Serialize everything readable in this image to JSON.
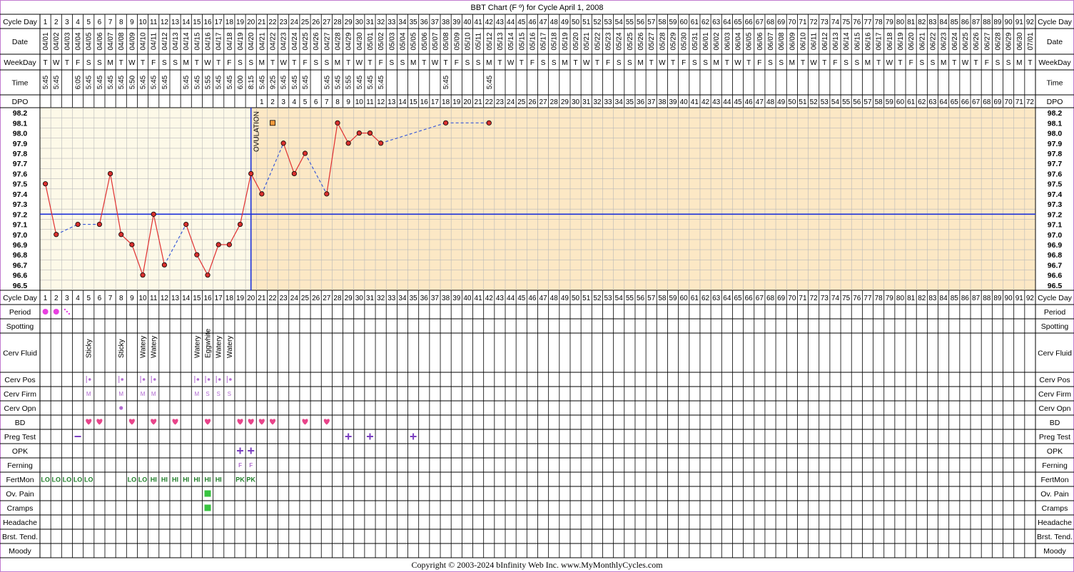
{
  "title": "BBT Chart (F º) for Cycle April 1, 2008",
  "footer": "Copyright © 2003-2024 bInfinity Web Inc.     www.MyMonthlyCycles.com",
  "ovulation_label": "OVULATION",
  "row_labels": {
    "cycle_day": "Cycle Day",
    "date": "Date",
    "weekday": "WeekDay",
    "time": "Time",
    "dpo": "DPO",
    "period": "Period",
    "spotting": "Spotting",
    "cerv_fluid": "Cerv Fluid",
    "cerv_pos": "Cerv Pos",
    "cerv_firm": "Cerv Firm",
    "cerv_opn": "Cerv Opn",
    "bd": "BD",
    "preg_test": "Preg Test",
    "opk": "OPK",
    "ferning": "Ferning",
    "fertmon": "FertMon",
    "ov_pain": "Ov. Pain",
    "cramps": "Cramps",
    "headache": "Headache",
    "brst_tend": "Brst. Tend.",
    "moody": "Moody"
  },
  "colors": {
    "frame": "#c27bcf",
    "pre_ovulation_bg": "#fdf9e8",
    "post_ovulation_bg": "#fce8c5",
    "temp_line": "#e03030",
    "temp_point": "#d8302e",
    "coverline": "#1a2fd8",
    "ovulation_line": "#1a2fd8",
    "period": "#e83fe0",
    "bd_heart": "#e8448a",
    "cervix_marker": "#b06ad0",
    "fertmon": "#1e7d28",
    "symptom": "#38c440",
    "plus_sign": "#7a3fc0"
  },
  "chart_data": {
    "type": "line",
    "title": "BBT Chart (F º) for Cycle April 1, 2008",
    "x_label": "Cycle Day",
    "y_label": "",
    "ylim": [
      96.5,
      98.2
    ],
    "y_ticks": [
      "98.2",
      "98.1",
      "98.0",
      "97.9",
      "97.8",
      "97.7",
      "97.6",
      "97.5",
      "97.4",
      "97.3",
      "97.2",
      "97.1",
      "97.0",
      "96.9",
      "96.8",
      "96.7",
      "96.6",
      "96.5"
    ],
    "coverline": 97.2,
    "ovulation_day": 20,
    "cycle_days": [
      1,
      2,
      3,
      4,
      5,
      6,
      7,
      8,
      9,
      10,
      11,
      12,
      13,
      14,
      15,
      16,
      17,
      18,
      19,
      20,
      21,
      22,
      23,
      24,
      25,
      26,
      27,
      28,
      29,
      30,
      31,
      32,
      33,
      34,
      35,
      36,
      37,
      38,
      39,
      40,
      41,
      42,
      43,
      44,
      45,
      46,
      47,
      48,
      49,
      50,
      51,
      52,
      53,
      54,
      55,
      56,
      57,
      58,
      59,
      60,
      61,
      62,
      63,
      64,
      65,
      66,
      67,
      68,
      69,
      70,
      71,
      72,
      73,
      74,
      75,
      76,
      77,
      78,
      79,
      80,
      81,
      82,
      83,
      84,
      85,
      86,
      87,
      88,
      89,
      90,
      91,
      92
    ],
    "dates": [
      "04/01",
      "04/02",
      "04/03",
      "04/04",
      "04/05",
      "04/06",
      "04/07",
      "04/08",
      "04/09",
      "04/10",
      "04/11",
      "04/12",
      "04/13",
      "04/14",
      "04/15",
      "04/16",
      "04/17",
      "04/18",
      "04/19",
      "04/20",
      "04/21",
      "04/22",
      "04/23",
      "04/24",
      "04/25",
      "04/26",
      "04/27",
      "04/28",
      "04/29",
      "04/30",
      "05/01",
      "05/02",
      "05/03",
      "05/04",
      "05/05",
      "05/06",
      "05/07",
      "05/08",
      "05/09",
      "05/10",
      "05/11",
      "05/12",
      "05/13",
      "05/14",
      "05/15",
      "05/16",
      "05/17",
      "05/18",
      "05/19",
      "05/20",
      "05/21",
      "05/22",
      "05/23",
      "05/24",
      "05/25",
      "05/26",
      "05/27",
      "05/28",
      "05/29",
      "05/30",
      "05/31",
      "06/01",
      "06/02",
      "06/03",
      "06/04",
      "06/05",
      "06/06",
      "06/07",
      "06/08",
      "06/09",
      "06/10",
      "06/11",
      "06/12",
      "06/13",
      "06/14",
      "06/15",
      "06/16",
      "06/17",
      "06/18",
      "06/19",
      "06/20",
      "06/21",
      "06/22",
      "06/23",
      "06/24",
      "06/25",
      "06/26",
      "06/27",
      "06/28",
      "06/29",
      "06/30",
      "07/01"
    ],
    "weekdays": [
      "T",
      "W",
      "T",
      "F",
      "S",
      "S",
      "M",
      "T",
      "W",
      "T",
      "F",
      "S",
      "S",
      "M",
      "T",
      "W",
      "T",
      "F",
      "S",
      "S",
      "M",
      "T",
      "W",
      "T",
      "F",
      "S",
      "S",
      "M",
      "T",
      "W",
      "T",
      "F",
      "S",
      "S",
      "M",
      "T",
      "W",
      "T",
      "F",
      "S",
      "S",
      "M",
      "T",
      "W",
      "T",
      "F",
      "S",
      "S",
      "M",
      "T",
      "W",
      "T",
      "F",
      "S",
      "S",
      "M",
      "T",
      "W",
      "T",
      "F",
      "S",
      "S",
      "M",
      "T",
      "W",
      "T",
      "F",
      "S",
      "S",
      "M",
      "T",
      "W",
      "T",
      "F",
      "S",
      "S",
      "M",
      "T",
      "W",
      "T",
      "F",
      "S",
      "S",
      "M",
      "T",
      "W",
      "T",
      "F",
      "S",
      "S",
      "M",
      "T"
    ],
    "times": [
      "5:45",
      "5:45",
      "",
      "6:05",
      "5:45",
      "5:45",
      "5:45",
      "5:45",
      "5:50",
      "5:45",
      "5:45",
      "5:45",
      "",
      "5:45",
      "5:45",
      "5:55",
      "5:45",
      "5:45",
      "6:00",
      "8:15",
      "5:45",
      "9:25",
      "5:45",
      "5:45",
      "5:45",
      "",
      "5:45",
      "5:45",
      "5:55",
      "5:45",
      "5:45",
      "5:45",
      "",
      "",
      "",
      "",
      "",
      "5:45",
      "",
      "",
      "",
      "5:45",
      "",
      "",
      "",
      "",
      "",
      "",
      "",
      "",
      "",
      "",
      "",
      "",
      "",
      "",
      "",
      "",
      "",
      "",
      "",
      "",
      "",
      "",
      "",
      "",
      "",
      "",
      "",
      "",
      "",
      "",
      "",
      "",
      "",
      "",
      "",
      "",
      "",
      "",
      "",
      "",
      "",
      "",
      "",
      "",
      "",
      "",
      "",
      "",
      "",
      "",
      "",
      "",
      "",
      "",
      "",
      ""
    ],
    "dpo": [
      "",
      "",
      "",
      "",
      "",
      "",
      "",
      "",
      "",
      "",
      "",
      "",
      "",
      "",
      "",
      "",
      "",
      "",
      "",
      "",
      "1",
      "2",
      "3",
      "4",
      "5",
      "6",
      "7",
      "8",
      "9",
      "10",
      "11",
      "12",
      "13",
      "14",
      "15",
      "16",
      "17",
      "18",
      "19",
      "20",
      "21",
      "22",
      "23",
      "24",
      "25",
      "26",
      "27",
      "28",
      "29",
      "30",
      "31",
      "32",
      "33",
      "34",
      "35",
      "36",
      "37",
      "38",
      "39",
      "40",
      "41",
      "42",
      "43",
      "44",
      "45",
      "46",
      "47",
      "48",
      "49",
      "50",
      "51",
      "52",
      "53",
      "54",
      "55",
      "56",
      "57",
      "58",
      "59",
      "60",
      "61",
      "62",
      "63",
      "64",
      "65",
      "66",
      "67",
      "68",
      "69",
      "70",
      "71",
      "72"
    ],
    "temperatures": [
      {
        "day": 1,
        "temp": 97.5
      },
      {
        "day": 2,
        "temp": 97.0
      },
      {
        "day": 4,
        "temp": 97.1
      },
      {
        "day": 6,
        "temp": 97.1
      },
      {
        "day": 7,
        "temp": 97.6
      },
      {
        "day": 8,
        "temp": 97.0
      },
      {
        "day": 9,
        "temp": 96.9
      },
      {
        "day": 10,
        "temp": 96.6
      },
      {
        "day": 11,
        "temp": 97.2
      },
      {
        "day": 12,
        "temp": 96.7
      },
      {
        "day": 14,
        "temp": 97.1
      },
      {
        "day": 15,
        "temp": 96.8
      },
      {
        "day": 16,
        "temp": 96.6
      },
      {
        "day": 17,
        "temp": 96.9
      },
      {
        "day": 18,
        "temp": 96.9
      },
      {
        "day": 19,
        "temp": 97.1
      },
      {
        "day": 20,
        "temp": 97.6
      },
      {
        "day": 21,
        "temp": 97.4
      },
      {
        "day": 23,
        "temp": 97.9
      },
      {
        "day": 24,
        "temp": 97.6
      },
      {
        "day": 25,
        "temp": 97.8
      },
      {
        "day": 27,
        "temp": 97.4
      },
      {
        "day": 28,
        "temp": 98.1
      },
      {
        "day": 29,
        "temp": 97.9
      },
      {
        "day": 30,
        "temp": 98.0
      },
      {
        "day": 31,
        "temp": 98.0
      },
      {
        "day": 32,
        "temp": 97.9
      },
      {
        "day": 38,
        "temp": 98.1
      },
      {
        "day": 42,
        "temp": 98.1
      }
    ],
    "discarded_temps": [
      {
        "day": 22,
        "temp": 98.1
      }
    ]
  },
  "tracking": {
    "period": [
      {
        "day": 1,
        "kind": "dot"
      },
      {
        "day": 2,
        "kind": "dot"
      },
      {
        "day": 3,
        "kind": "spot"
      }
    ],
    "cerv_fluid": [
      {
        "day": 5,
        "label": "Sticky"
      },
      {
        "day": 8,
        "label": "Sticky"
      },
      {
        "day": 10,
        "label": "Watery"
      },
      {
        "day": 11,
        "label": "Watery"
      },
      {
        "day": 15,
        "label": "Watery"
      },
      {
        "day": 16,
        "label": "Eggwhite"
      },
      {
        "day": 17,
        "label": "Watery"
      },
      {
        "day": 18,
        "label": "Watery"
      }
    ],
    "cerv_pos": [
      5,
      8,
      10,
      11,
      15,
      16,
      17,
      18
    ],
    "cerv_firm": [
      {
        "day": 5,
        "label": "M"
      },
      {
        "day": 8,
        "label": "M"
      },
      {
        "day": 10,
        "label": "M"
      },
      {
        "day": 11,
        "label": "M"
      },
      {
        "day": 15,
        "label": "M"
      },
      {
        "day": 16,
        "label": "S"
      },
      {
        "day": 17,
        "label": "S"
      },
      {
        "day": 18,
        "label": "S"
      }
    ],
    "cerv_opn": [
      8
    ],
    "bd": [
      5,
      6,
      9,
      11,
      13,
      16,
      19,
      20,
      21,
      22,
      25,
      27
    ],
    "preg_test": [
      {
        "day": 4,
        "result": "negative"
      },
      {
        "day": 29,
        "result": "positive"
      },
      {
        "day": 31,
        "result": "positive"
      },
      {
        "day": 35,
        "result": "positive"
      }
    ],
    "opk": [
      {
        "day": 19,
        "result": "positive"
      },
      {
        "day": 20,
        "result": "positive"
      }
    ],
    "ferning": [
      {
        "day": 19,
        "label": "F"
      },
      {
        "day": 20,
        "label": "F"
      }
    ],
    "fertmon": [
      {
        "day": 1,
        "label": "LO"
      },
      {
        "day": 2,
        "label": "LO"
      },
      {
        "day": 3,
        "label": "LO"
      },
      {
        "day": 4,
        "label": "LO"
      },
      {
        "day": 5,
        "label": "LO"
      },
      {
        "day": 9,
        "label": "LO"
      },
      {
        "day": 10,
        "label": "LO"
      },
      {
        "day": 11,
        "label": "HI"
      },
      {
        "day": 12,
        "label": "HI"
      },
      {
        "day": 13,
        "label": "HI"
      },
      {
        "day": 14,
        "label": "HI"
      },
      {
        "day": 15,
        "label": "HI"
      },
      {
        "day": 16,
        "label": "HI"
      },
      {
        "day": 17,
        "label": "HI"
      },
      {
        "day": 19,
        "label": "PK"
      },
      {
        "day": 20,
        "label": "PK"
      }
    ],
    "ov_pain": [
      16
    ],
    "cramps": [
      16
    ]
  }
}
